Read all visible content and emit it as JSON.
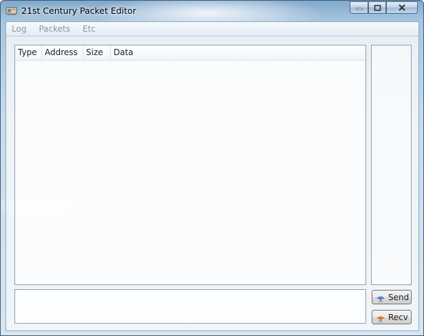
{
  "window": {
    "title": "21st Century Packet Editor"
  },
  "menu": {
    "items": [
      "Log",
      "Packets",
      "Etc"
    ]
  },
  "packet_list": {
    "columns": [
      "Type",
      "Address",
      "Size",
      "Data"
    ],
    "rows": []
  },
  "input": {
    "value": ""
  },
  "buttons": {
    "send": "Send",
    "recv": "Recv"
  },
  "icons": {
    "app": "app-window-icon",
    "minimize": "minimize-icon",
    "maximize": "maximize-icon",
    "close": "close-icon",
    "send": "send-signal-icon",
    "recv": "recv-signal-icon"
  },
  "colors": {
    "send_icon": "#4a84c4",
    "recv_icon": "#d8742a"
  }
}
